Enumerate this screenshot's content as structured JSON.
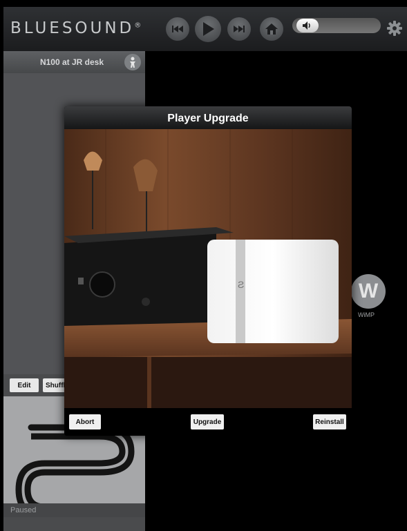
{
  "header": {
    "logo_text": "BLUESOUND",
    "logo_mark": "®",
    "controls": [
      "previous-icon",
      "play-icon",
      "next-icon",
      "home-icon",
      "volume-icon",
      "gear-icon"
    ]
  },
  "player": {
    "name": "N100 at JR desk",
    "icon": "person-icon"
  },
  "queue": {
    "edit_label": "Edit",
    "shuffle_label": "Shuffl"
  },
  "now_playing": {
    "status": "Paused"
  },
  "services": [
    {
      "letter": "W",
      "label": "WiMP"
    }
  ],
  "modal": {
    "title": "Player Upgrade",
    "abort_label": "Abort",
    "upgrade_label": "Upgrade",
    "reinstall_label": "Reinstall"
  },
  "colors": {
    "accent": "#ffffff",
    "panel": "#4a4b4d",
    "header": "#2f3134"
  }
}
